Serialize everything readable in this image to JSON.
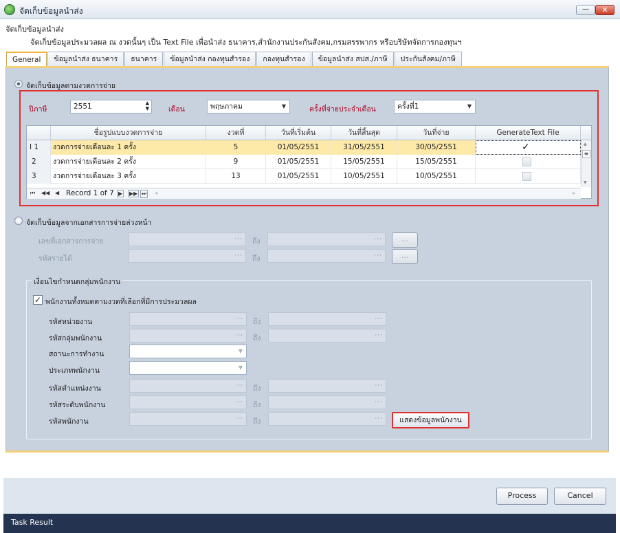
{
  "window": {
    "title": "จัดเก็บข้อมูลนำส่ง",
    "minimize_glyph": "—",
    "close_glyph": "✕"
  },
  "header": {
    "title": "จัดเก็บข้อมูลนำส่ง",
    "description": "จัดเก็บข้อมูลประมวลผล ณ งวดนั้นๆ เป็น Text File เพื่อนำส่ง ธนาคาร,สำนักงานประกันสังคม,กรมสรรพากร หรือบริษัทจัดการกองทุนฯ"
  },
  "tabs": [
    {
      "label": "General",
      "active": true
    },
    {
      "label": "ข้อมูลนำส่ง ธนาคาร"
    },
    {
      "label": "ธนาคาร"
    },
    {
      "label": "ข้อมูลนำส่ง กองทุนสำรอง"
    },
    {
      "label": "กองทุนสำรอง"
    },
    {
      "label": "ข้อมูลนำส่ง สปส./ภาษี"
    },
    {
      "label": "ประกันสังคม/ภาษี"
    }
  ],
  "section_period": {
    "radio_label": "จัดเก็บข้อมูลตามงวดการจ่าย",
    "year_label": "ปีภาษี",
    "year_value": "2551",
    "month_label": "เดือน",
    "month_value": "พฤษภาคม",
    "times_label": "ครั้งที่จ่ายประจำเดือน",
    "times_value": "ครั้งที่1"
  },
  "grid": {
    "columns": [
      "ชื่อรูปแบบงวดการจ่าย",
      "งวดที่",
      "วันที่เริ่มต้น",
      "วันที่สิ้นสุด",
      "วันที่จ่าย",
      "GenerateText File"
    ],
    "rows": [
      {
        "no": "1",
        "name": "งวดการจ่ายเดือนละ 1 ครั้ง",
        "period": "5",
        "start": "01/05/2551",
        "end": "31/05/2551",
        "pay": "30/05/2551",
        "checked": true,
        "check_glyph": "✓"
      },
      {
        "no": "2",
        "name": "งวดการจ่ายเดือนละ 2 ครั้ง",
        "period": "9",
        "start": "01/05/2551",
        "end": "15/05/2551",
        "pay": "15/05/2551",
        "checked": false
      },
      {
        "no": "3",
        "name": "งวดการจ่ายเดือนละ 3 ครั้ง",
        "period": "13",
        "start": "01/05/2551",
        "end": "10/05/2551",
        "pay": "10/05/2551",
        "checked": false
      }
    ],
    "record_text": "Record 1 of 7"
  },
  "section_doc": {
    "radio_label": "จัดเก็บข้อมูลจากเอกสารการจ่ายล่วงหน้า",
    "doc_no_label": "เลขที่เอกสารการจ่าย",
    "income_code_label": "รหัสรายได้",
    "to_label": "ถึง",
    "browse_label": "..."
  },
  "employee_group": {
    "title": "เงื่อนไขกำหนดกลุ่มพนักงาน",
    "all_checkbox_label": "พนักงานทั้งหมดตามงวดที่เลือกที่มีการประมวลผล",
    "all_checked": true,
    "check_glyph": "✓",
    "dept_label": "รหัสหน่วยงาน",
    "group_label": "รหัสกลุ่มพนักงาน",
    "status_label": "สถานะการทำงาน",
    "type_label": "ประเภทพนักงาน",
    "position_label": "รหัสตำแหน่งงาน",
    "level_label": "รหัสระดับพนักงาน",
    "emp_label": "รหัสพนักงาน",
    "to_label": "ถึง",
    "show_button": "แสดงข้อมูลพนักงาน"
  },
  "footer": {
    "process_label": "Process",
    "cancel_label": "Cancel"
  },
  "taskbar": {
    "label": "Task Result"
  },
  "icons": [
    "app-icon",
    "minimize-icon",
    "close-icon",
    "dropdown-arrow-icon",
    "spin-up-icon",
    "spin-down-icon",
    "ellipsis-icon",
    "checkmark-icon",
    "nav-first-icon",
    "nav-prev-page-icon",
    "nav-prev-icon",
    "nav-next-icon",
    "nav-next-page-icon",
    "nav-last-icon"
  ],
  "colors": {
    "accent": "#f0b23c",
    "highlight_row": "#fde9a8",
    "label_red": "#b00020",
    "panel_bg": "#c8d2df",
    "taskbar": "#243450"
  }
}
